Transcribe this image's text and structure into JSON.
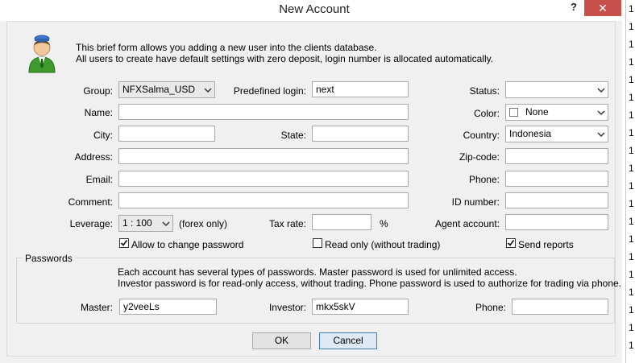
{
  "window": {
    "title": "New Account",
    "help_label": "?",
    "close_label": "✕"
  },
  "right_strip": [
    "1",
    "1",
    "1",
    "1",
    "1",
    "1",
    "1",
    "1",
    "1",
    "1",
    "1",
    "1",
    "1",
    "1",
    "1",
    "1",
    "1",
    "1",
    "1",
    "1"
  ],
  "intro": {
    "line1": "This brief form allows you adding a new user into the clients database.",
    "line2": "All users to create have default settings with zero deposit, login number is allocated automatically."
  },
  "form": {
    "group_label": "Group:",
    "group_value": "NFXSalma_USD",
    "predefined_login_label": "Predefined login:",
    "predefined_login_value": "next",
    "status_label": "Status:",
    "status_value": "",
    "name_label": "Name:",
    "name_value": "",
    "color_label": "Color:",
    "color_value": "None",
    "city_label": "City:",
    "city_value": "",
    "state_label": "State:",
    "state_value": "",
    "country_label": "Country:",
    "country_value": "Indonesia",
    "address_label": "Address:",
    "address_value": "",
    "zip_label": "Zip-code:",
    "zip_value": "",
    "email_label": "Email:",
    "email_value": "",
    "phone_label": "Phone:",
    "phone_value": "",
    "comment_label": "Comment:",
    "comment_value": "",
    "id_label": "ID number:",
    "id_value": "",
    "leverage_label": "Leverage:",
    "leverage_value": "1 : 100",
    "leverage_note": "(forex only)",
    "taxrate_label": "Tax rate:",
    "taxrate_value": "",
    "taxrate_unit": "%",
    "agent_label": "Agent account:",
    "agent_value": ""
  },
  "checkboxes": {
    "allow_change_password": {
      "label": "Allow to change password",
      "checked": true
    },
    "read_only": {
      "label": "Read only (without trading)",
      "checked": false
    },
    "send_reports": {
      "label": "Send reports",
      "checked": true
    }
  },
  "passwords": {
    "group_title": "Passwords",
    "info_line1": "Each account has several types of passwords. Master password is used for unlimited access.",
    "info_line2": "Investor password is for read-only access, without trading. Phone password is used to authorize for trading via phone.",
    "master_label": "Master:",
    "master_value": "y2veeLs",
    "investor_label": "Investor:",
    "investor_value": "mkx5skV",
    "phone_label": "Phone:",
    "phone_value": ""
  },
  "buttons": {
    "ok": "OK",
    "cancel": "Cancel"
  }
}
